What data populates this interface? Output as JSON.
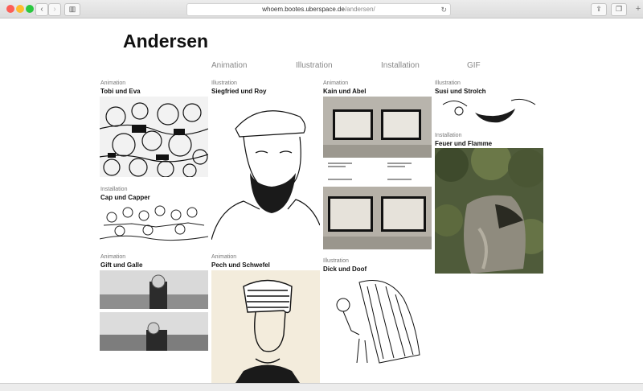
{
  "browser": {
    "url_host": "whoem.bootes.uberspace.de",
    "url_path": "/andersen/"
  },
  "page": {
    "title": "Andersen"
  },
  "filters": [
    "Animation",
    "Illustration",
    "Installation",
    "GIF"
  ],
  "items": [
    {
      "category": "Animation",
      "title": "Tobi und Eva"
    },
    {
      "category": "Installation",
      "title": "Cap und Capper"
    },
    {
      "category": "Animation",
      "title": "Gift und Galle"
    },
    {
      "category": "Illustration",
      "title": "Siegfried und Roy"
    },
    {
      "category": "Animation",
      "title": "Pech und Schwefel"
    },
    {
      "category": "Animation",
      "title": "Kain und Abel"
    },
    {
      "category": "Illustration",
      "title": "Dick und Doof"
    },
    {
      "category": "Illustration",
      "title": "Susi und Strolch"
    },
    {
      "category": "Installation",
      "title": "Feuer und Flamme"
    }
  ]
}
